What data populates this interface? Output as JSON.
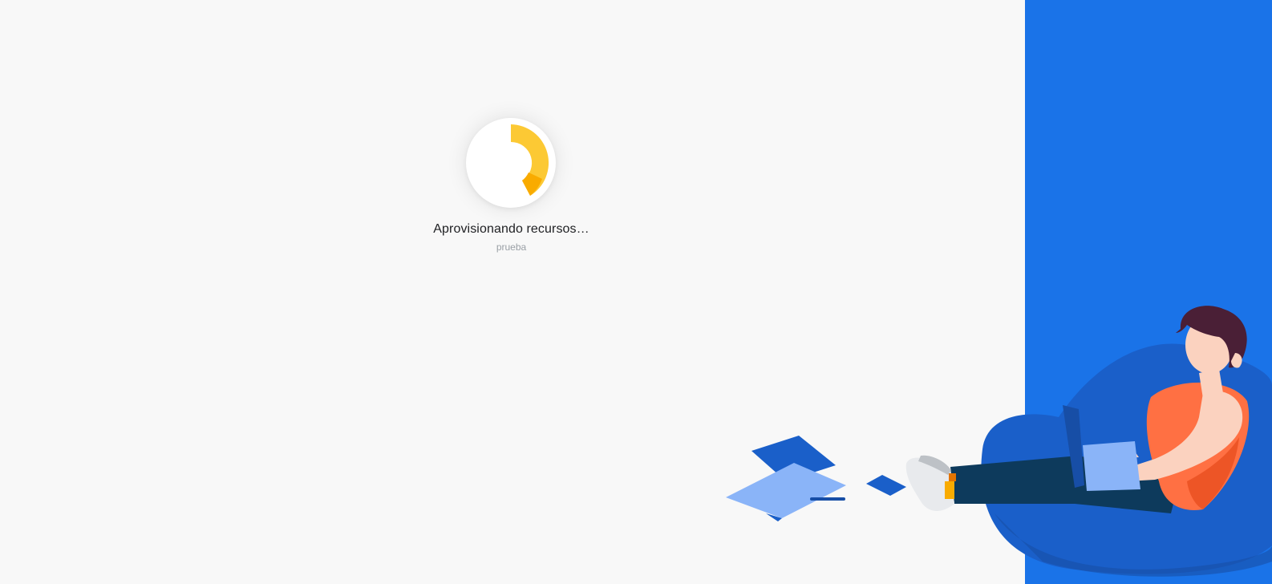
{
  "status": {
    "title": "Aprovisionando recursos…",
    "subtitle": "prueba"
  },
  "loader": {
    "icon": "spinner-icon",
    "colors": {
      "primary": "#fcc934",
      "secondary": "#f9ab00"
    }
  },
  "theme": {
    "background": "#f8f8f8",
    "accent": "#1a73e8"
  }
}
